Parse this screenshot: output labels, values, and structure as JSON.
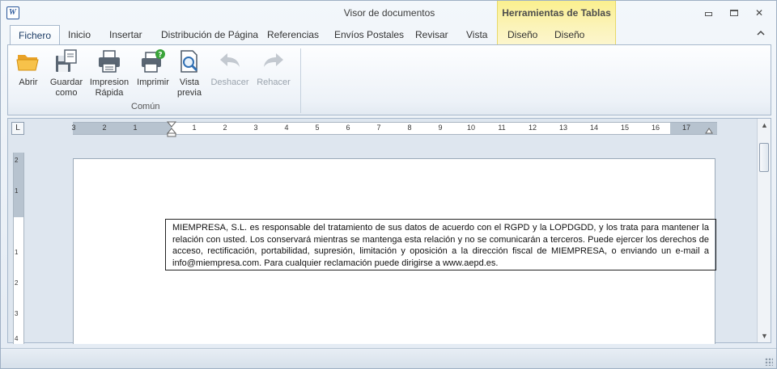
{
  "window": {
    "title": "Visor de documentos",
    "context_tab_title": "Herramientas de Tablas",
    "app_icon_letter": "W",
    "minimize": "▭",
    "restore": "❐",
    "close": "✕"
  },
  "tabs": [
    {
      "label": "Fichero",
      "active": true
    },
    {
      "label": "Inicio"
    },
    {
      "label": "Insertar"
    },
    {
      "label": "Distribución de Página"
    },
    {
      "label": "Referencias"
    },
    {
      "label": "Envíos Postales"
    },
    {
      "label": "Revisar"
    },
    {
      "label": "Vista"
    },
    {
      "label": "Diseño"
    },
    {
      "label": "Diseño"
    }
  ],
  "ribbon": {
    "group_label": "Común",
    "buttons": [
      {
        "label": "Abrir",
        "icon": "folder-open-icon"
      },
      {
        "label": "Guardar como",
        "icon": "save-as-icon"
      },
      {
        "label": "Impresion Rápida",
        "icon": "quick-print-icon"
      },
      {
        "label": "Imprimir",
        "icon": "print-icon"
      },
      {
        "label": "Vista previa",
        "icon": "print-preview-icon"
      },
      {
        "label": "Deshacer",
        "icon": "undo-icon",
        "disabled": true
      },
      {
        "label": "Rehacer",
        "icon": "redo-icon",
        "disabled": true
      }
    ]
  },
  "ruler": {
    "corner": "L",
    "h_numbers_left": [
      "3",
      "2",
      "1"
    ],
    "h_numbers_right": [
      "1",
      "2",
      "3",
      "4",
      "5",
      "6",
      "7",
      "8",
      "9",
      "10",
      "11",
      "12",
      "13",
      "14",
      "15",
      "16",
      "17"
    ],
    "v_numbers": [
      "2",
      "1",
      "1",
      "2",
      "3",
      "4"
    ]
  },
  "document": {
    "textbox": "MIEMPRESA, S.L. es responsable del tratamiento de sus datos de acuerdo con el RGPD y la LOPDGDD, y los trata para mantener la relación con usted. Los conservará mientras se mantenga esta relación y no se comunicarán a terceros. Puede ejercer los derechos de acceso, rectificación, portabilidad, supresión, limitación y oposición a la dirección fiscal de MIEMPRESA, o enviando un e-mail a info@miempresa.com. Para cualquier reclamación puede dirigirse a www.aepd.es."
  },
  "scrollbar": {
    "up": "▲",
    "down": "▼"
  },
  "colors": {
    "accent": "#2b579a",
    "context_tab": "#fbf08e",
    "ribbon_border": "#a7b8cc"
  }
}
